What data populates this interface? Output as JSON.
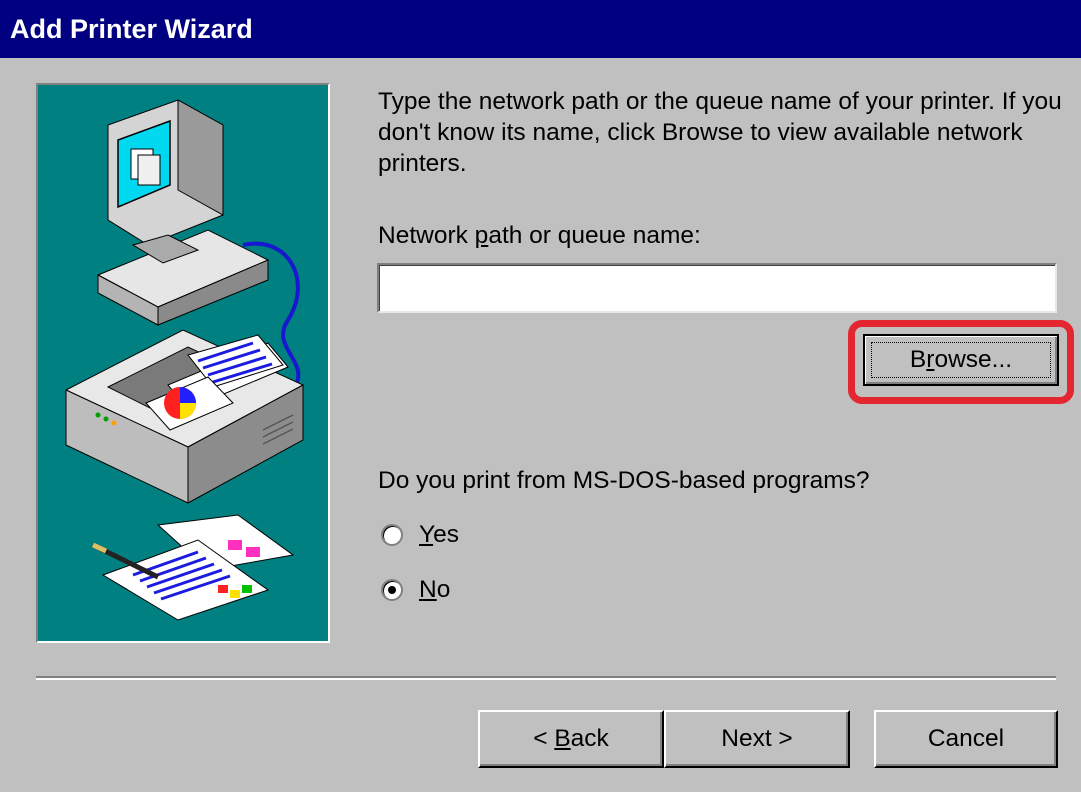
{
  "window": {
    "title": "Add Printer Wizard"
  },
  "main": {
    "intro_text": "Type the network path or the queue name of your printer. If you don't know its name, click Browse to view available network printers.",
    "path_label_pre": "Network ",
    "path_label_mnemonic": "p",
    "path_label_post": "ath or queue name:",
    "path_value": "",
    "browse_label_pre": "B",
    "browse_label_mnemonic": "r",
    "browse_label_post": "owse...",
    "question": "Do you print from MS-DOS-based programs?",
    "options": [
      {
        "mnemonic": "Y",
        "rest": "es",
        "checked": false
      },
      {
        "mnemonic": "N",
        "rest": "o",
        "checked": true
      }
    ]
  },
  "footer": {
    "back_prefix": "< ",
    "back_mnemonic": "B",
    "back_rest": "ack",
    "next_label": "Next >",
    "cancel_label": "Cancel"
  },
  "colors": {
    "title_bar": "#000080",
    "illustration_bg": "#008080",
    "dialog_bg": "#c0c0c0",
    "highlight_ring": "#e3262f"
  },
  "icons": [
    "computer-illustration",
    "printer-illustration",
    "printed-pages-illustration",
    "network-cable-illustration"
  ]
}
